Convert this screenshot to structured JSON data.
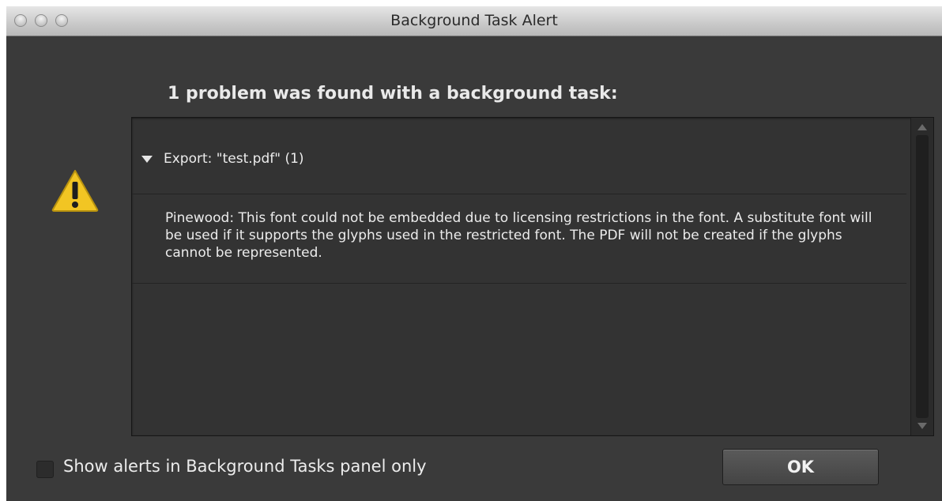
{
  "window": {
    "title": "Background Task Alert"
  },
  "alert": {
    "heading": "1 problem was found with a background task:",
    "icon": "warning-icon",
    "task": {
      "label": "Export: \"test.pdf\" (1)"
    },
    "message": "Pinewood: This font could not be embedded due to licensing restrictions in the font. A substitute font will be used if it supports the glyphs used in the restricted font. The PDF will not be created if the glyphs cannot be represented."
  },
  "footer": {
    "checkbox_label": "Show alerts in Background Tasks panel only",
    "checkbox_checked": false,
    "ok_label": "OK"
  },
  "colors": {
    "window_bg": "#3a3a3a",
    "panel_bg": "#333333",
    "warning_yellow": "#f2c523"
  }
}
